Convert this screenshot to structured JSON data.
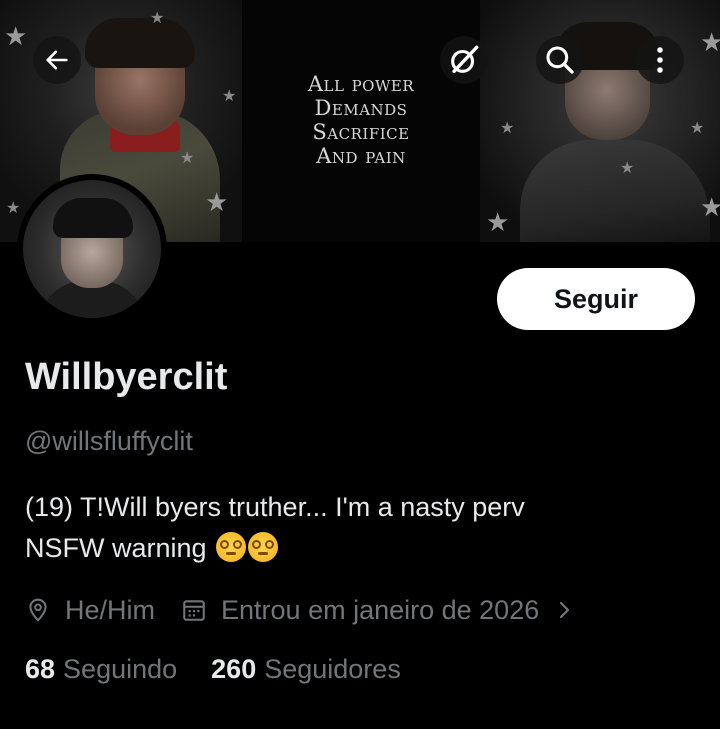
{
  "banner": {
    "text_lines": [
      "All power",
      "Demands",
      "Sacrifice",
      "And pain"
    ]
  },
  "top_bar": {
    "icons": [
      "back-arrow-icon",
      "grok-icon",
      "search-icon",
      "more-vertical-icon"
    ]
  },
  "profile": {
    "follow_label": "Seguir",
    "display_name": "Willbyerclit",
    "handle": "@willsfluffyclit",
    "bio_line1": "(19) T!Will byers truther... I'm a nasty perv",
    "bio_line2": "NSFW warning",
    "bio_emojis": [
      "dizzy-face-emoji",
      "dizzy-face-emoji"
    ],
    "pronouns": "He/Him",
    "joined": "Entrou em janeiro de 2026",
    "following_count": "68",
    "following_label": "Seguindo",
    "followers_count": "260",
    "followers_label": "Seguidores"
  },
  "colors": {
    "background": "#000000",
    "primary_text": "#e7e9ea",
    "secondary_text": "#71767b",
    "button_bg": "#ffffff",
    "button_text": "#0f1419"
  }
}
